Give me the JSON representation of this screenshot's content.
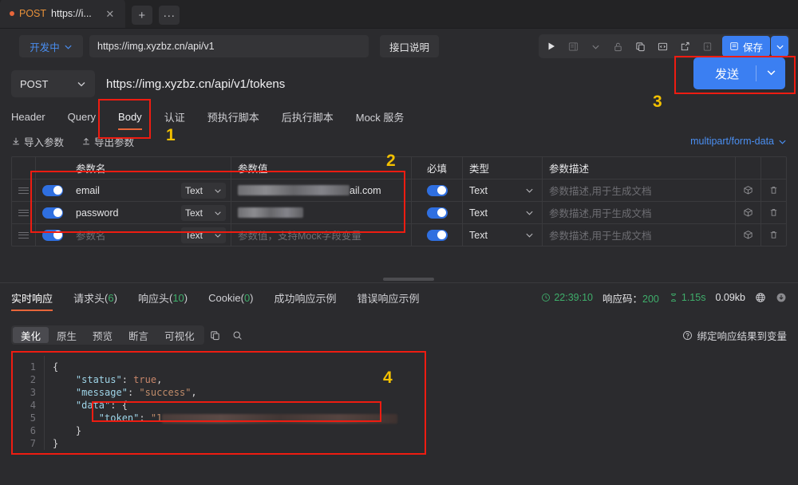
{
  "tabstrip": {
    "tab": {
      "method": "POST",
      "title": "https://i...",
      "close": "✕"
    },
    "new_tab": "+",
    "more": "···"
  },
  "envbar": {
    "environment": "开发中",
    "base_url": "https://img.xyzbz.cn/api/v1",
    "api_doc_button": "接口说明",
    "save_button": "保存"
  },
  "request": {
    "method": "POST",
    "url": "https://img.xyzbz.cn/api/v1/tokens",
    "send_button": "发送"
  },
  "param_tabs": [
    {
      "label": "Header",
      "active": false
    },
    {
      "label": "Query",
      "active": false
    },
    {
      "label": "Body",
      "active": true
    },
    {
      "label": "认证",
      "active": false
    },
    {
      "label": "预执行脚本",
      "active": false
    },
    {
      "label": "后执行脚本",
      "active": false
    },
    {
      "label": "Mock 服务",
      "active": false
    }
  ],
  "param_actions": {
    "import": "导入参数",
    "export": "导出参数",
    "content_type": "multipart/form-data"
  },
  "param_table": {
    "headers": {
      "name": "参数名",
      "value": "参数值",
      "required": "必填",
      "type": "类型",
      "description": "参数描述"
    },
    "rows": [
      {
        "name": "email",
        "type": "Text",
        "value_suffix": "ail.com",
        "value_redacted": true,
        "value_placeholder": "",
        "description_placeholder": "参数描述,用于生成文档",
        "enabled": true,
        "required": true,
        "type2": "Text"
      },
      {
        "name": "password",
        "type": "Text",
        "value_suffix": "",
        "value_redacted": true,
        "value_placeholder": "",
        "description_placeholder": "参数描述,用于生成文档",
        "enabled": true,
        "required": true,
        "type2": "Text"
      },
      {
        "name": "",
        "name_placeholder": "参数名",
        "type": "Text",
        "value_suffix": "",
        "value_redacted": false,
        "value_placeholder": "参数值，支持Mock字段变量",
        "description_placeholder": "参数描述,用于生成文档",
        "enabled": true,
        "required": true,
        "type2": "Text"
      }
    ]
  },
  "response_tabs": [
    {
      "label": "实时响应",
      "count": "",
      "active": true
    },
    {
      "label": "请求头",
      "count": "6",
      "active": false
    },
    {
      "label": "响应头",
      "count": "10",
      "active": false
    },
    {
      "label": "Cookie",
      "count": "0",
      "active": false
    },
    {
      "label": "成功响应示例",
      "count": "",
      "active": false
    },
    {
      "label": "错误响应示例",
      "count": "",
      "active": false
    }
  ],
  "status": {
    "time": "22:39:10",
    "code_label": "响应码：",
    "code_value": "200",
    "duration": "1.15s",
    "size": "0.09kb"
  },
  "format_tabs": [
    {
      "label": "美化",
      "active": true
    },
    {
      "label": "原生",
      "active": false
    },
    {
      "label": "预览",
      "active": false
    },
    {
      "label": "断言",
      "active": false
    },
    {
      "label": "可视化",
      "active": false
    }
  ],
  "bind_variable": "绑定响应结果到变量",
  "code": {
    "line_numbers": [
      "1",
      "2",
      "3",
      "4",
      "5",
      "6",
      "7"
    ],
    "lines": [
      "{",
      "    \"status\": true,",
      "    \"message\": \"success\",",
      "    \"data\": {",
      "        \"token\": \"1",
      "    }",
      "}"
    ]
  },
  "annotations": [
    {
      "number": "1"
    },
    {
      "number": "2"
    },
    {
      "number": "3"
    },
    {
      "number": "4"
    }
  ],
  "colors": {
    "accent_blue": "#3b7ff2",
    "accent_orange": "#e8663a",
    "annotation_red": "#ee1c11",
    "annotation_yellow": "#f2c000",
    "status_green": "#3fae6b",
    "background": "#2b2b2e"
  }
}
